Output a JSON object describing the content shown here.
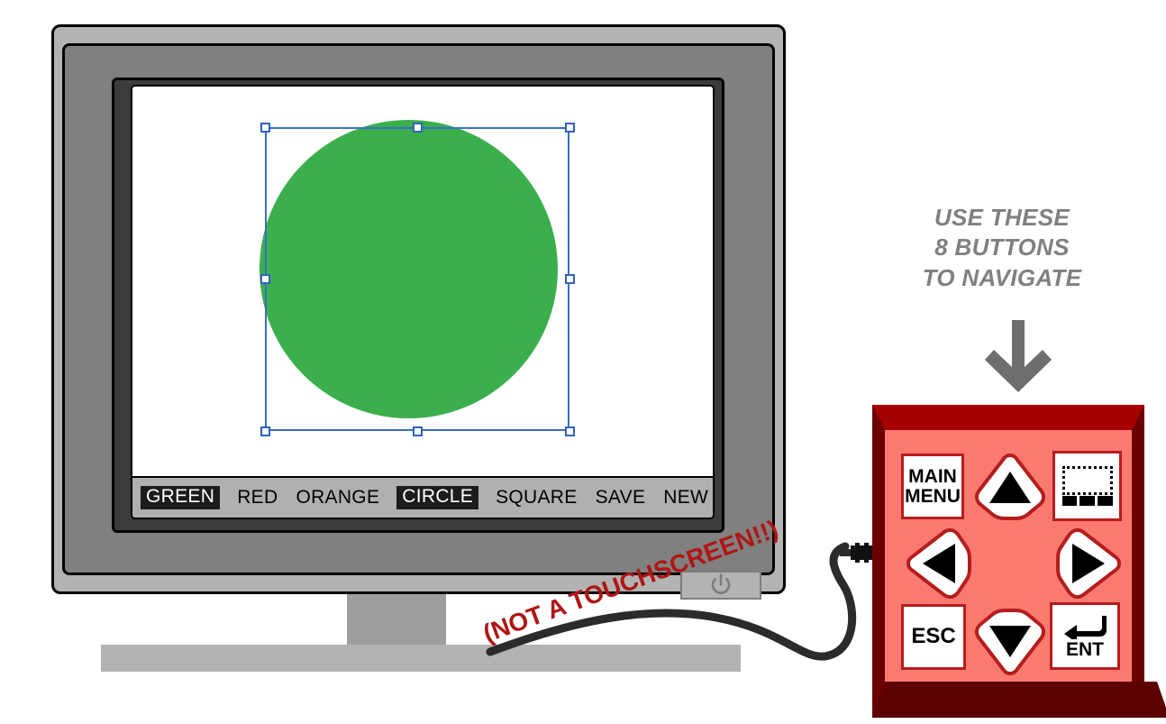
{
  "device": {
    "type": "crt-monitor-with-keypad",
    "monitor_body_color": "#b3b3b3",
    "bezel_color": "#808080",
    "inner_bezel_color": "#3b3b3b",
    "screen_color": "#ffffff"
  },
  "screen": {
    "shape": {
      "kind": "circle",
      "fill_color": "#3aaf4c",
      "selected": true
    },
    "selection": {
      "outline_color": "#3b6fc4",
      "handle_fill": "#ffffff",
      "handle_count": 8
    }
  },
  "toolbar": {
    "color_group": {
      "options": [
        "GREEN",
        "RED",
        "ORANGE"
      ],
      "selected": "GREEN"
    },
    "shape_group": {
      "options": [
        "CIRCLE",
        "SQUARE"
      ],
      "selected": "CIRCLE"
    },
    "actions": [
      "SAVE",
      "NEW"
    ],
    "save_label": "SAVE",
    "new_label": "NEW",
    "selected_bg": "#1c1c1c",
    "selected_fg": "#ffffff",
    "bar_bg": "#b0b0b0"
  },
  "power_button": {
    "icon": "power-icon",
    "label": ""
  },
  "annotations": {
    "touchscreen_warning": "(NOT A TOUCHSCREEN!!)",
    "touchscreen_warning_color": "#b01515",
    "navigate_hint_line1": "USE THESE",
    "navigate_hint_line2": "8 BUTTONS",
    "navigate_hint_line3": "TO NAVIGATE",
    "navigate_hint_color": "#808080",
    "navigate_arrow_icon": "arrow-down-icon"
  },
  "keypad": {
    "face_color": "#fa7a72",
    "frame_color": "#6b0000",
    "button_border_color": "#b51d1d",
    "button_count": 8,
    "buttons": [
      {
        "id": "main-menu",
        "line1": "MAIN",
        "line2": "MENU",
        "icon": ""
      },
      {
        "id": "up",
        "line1": "",
        "line2": "",
        "icon": "arrow-up-icon"
      },
      {
        "id": "screen",
        "line1": "",
        "line2": "",
        "icon": "screen-toggle-icon"
      },
      {
        "id": "left",
        "line1": "",
        "line2": "",
        "icon": "arrow-left-icon"
      },
      {
        "id": "right",
        "line1": "",
        "line2": "",
        "icon": "arrow-right-icon"
      },
      {
        "id": "esc",
        "line1": "ESC",
        "line2": "",
        "icon": ""
      },
      {
        "id": "down",
        "line1": "",
        "line2": "",
        "icon": "arrow-down-icon"
      },
      {
        "id": "enter",
        "line1": "ENT",
        "line2": "",
        "icon": "enter-return-icon"
      }
    ],
    "main_menu_line1": "MAIN",
    "main_menu_line2": "MENU",
    "esc_label": "ESC",
    "ent_label": "ENT"
  },
  "cable": {
    "color": "#2b2b2b",
    "connector_color": "#111111"
  }
}
